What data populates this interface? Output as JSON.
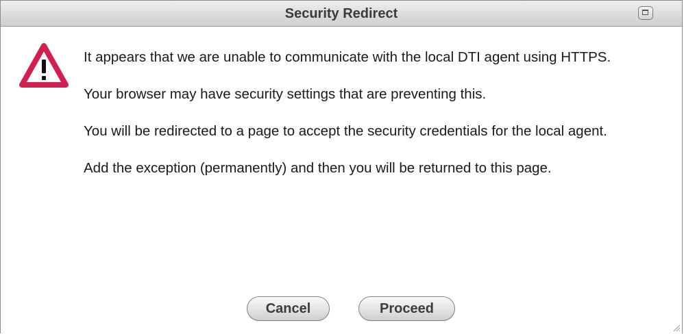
{
  "dialog": {
    "title": "Security Redirect",
    "maximize_icon": "maximize-icon",
    "warning_icon": "warning-triangle-icon",
    "warning_color": "#d11f52",
    "paragraphs": [
      "It appears that we are unable to communicate with the local DTI agent using HTTPS.",
      "Your browser may have security settings that are preventing this.",
      "You will be redirected to a page to accept the security credentials for the local agent.",
      "Add the exception (permanently) and then you will be returned to this page."
    ],
    "buttons": {
      "cancel_label": "Cancel",
      "proceed_label": "Proceed"
    },
    "resize_icon": "resize-grip-icon"
  }
}
